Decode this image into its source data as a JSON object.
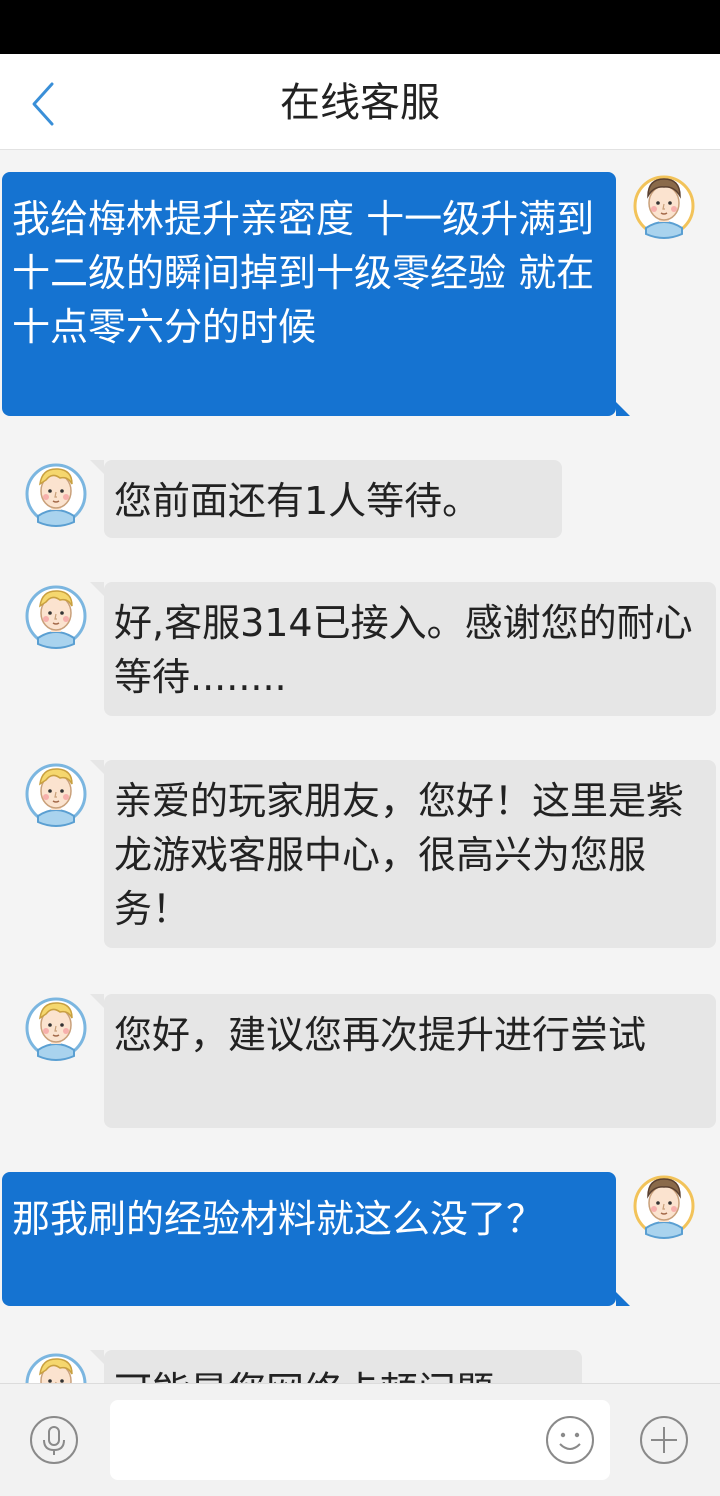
{
  "header": {
    "title": "在线客服"
  },
  "messages": [
    {
      "sender": "user",
      "text": "我给梅林提升亲密度 十一级升满到十二级的瞬间掉到十级零经验 就在十点零六分的时候"
    },
    {
      "sender": "agent",
      "text": "您前面还有1人等待。"
    },
    {
      "sender": "agent",
      "text": "好,客服314已接入。感谢您的耐心等待........"
    },
    {
      "sender": "agent",
      "text": "亲爱的玩家朋友，您好！这里是紫龙游戏客服中心，很高兴为您服务！"
    },
    {
      "sender": "agent",
      "text": "您好，建议您再次提升进行尝试"
    },
    {
      "sender": "user",
      "text": "那我刷的经验材料就这么没了？"
    },
    {
      "sender": "agent",
      "text": "可能是您网络卡顿问题"
    }
  ],
  "input": {
    "value": "",
    "placeholder": ""
  },
  "icons": {
    "back": "chevron-left-icon",
    "mic": "microphone-icon",
    "emoji": "smiley-icon",
    "plus": "plus-icon"
  },
  "colors": {
    "user_bubble": "#1573d1",
    "agent_bubble": "#e6e6e6",
    "accent": "#3a8fd8"
  }
}
